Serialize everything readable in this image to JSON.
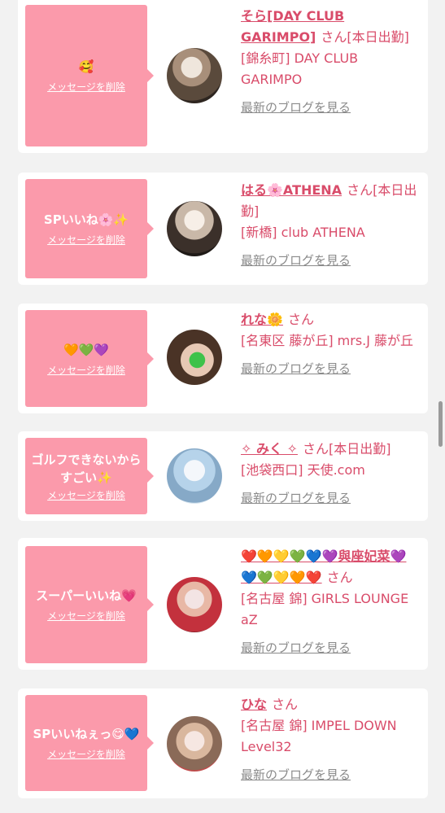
{
  "labels": {
    "delete": "メッセージを削除",
    "blog": "最新のブログを見る",
    "san": "さん"
  },
  "cards": [
    {
      "message": "🥰",
      "name": "そら[DAY CLUB GARIMPO]",
      "status": "[本日出勤]",
      "shop": "[錦糸町] DAY CLUB GARIMPO"
    },
    {
      "message": "SPいいね🌸✨",
      "name": "はる🌸ATHENA",
      "status": "[本日出勤]",
      "shop": "[新橋] club ATHENA"
    },
    {
      "message": "🧡💚💜",
      "name": "れな🌼",
      "status": "",
      "shop": "[名東区 藤が丘] mrs.J 藤が丘"
    },
    {
      "message": "ゴルフできないからすごい✨",
      "name": "✧ みく ✧",
      "status": "[本日出勤]",
      "shop": "[池袋西口] 天使.com"
    },
    {
      "message": "スーパーいいね💗",
      "name": "❤️🧡💛💚💙💜與座妃菜💜💙💚💛🧡❤️",
      "status": "",
      "shop": "[名古屋 錦] GIRLS LOUNGE aZ"
    },
    {
      "message": "SPいいねぇっ😋💙",
      "name": "ひな",
      "status": "",
      "shop": "[名古屋 錦] IMPEL DOWN Level32"
    }
  ],
  "colors": {
    "accent": "#d94c6a",
    "bubble": "#fb9aab",
    "background": "#f2f2f2"
  }
}
